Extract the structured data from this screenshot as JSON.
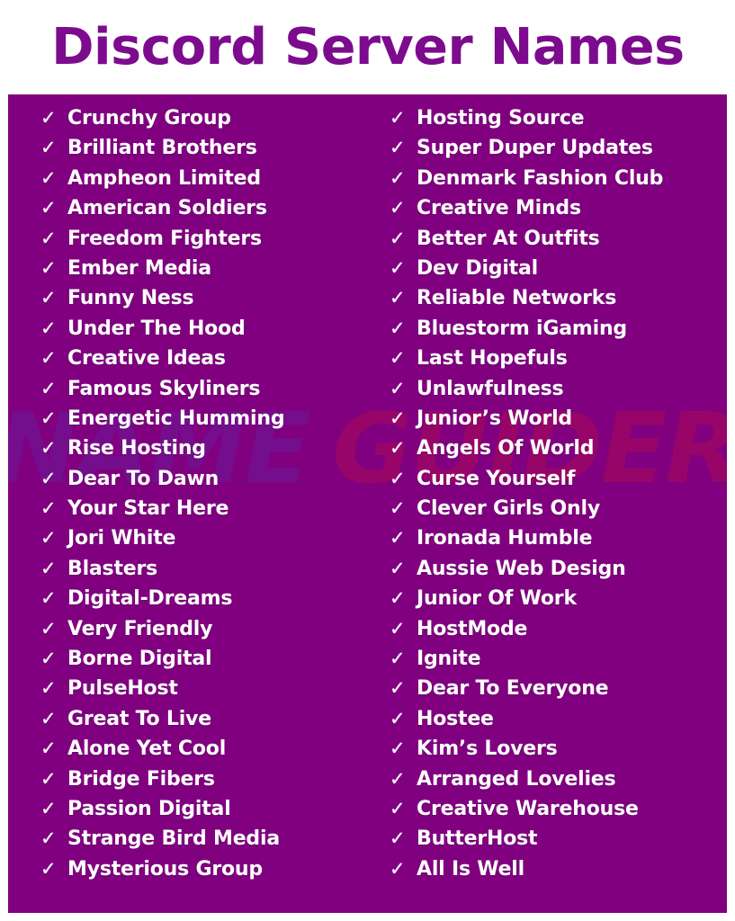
{
  "page": {
    "title": "Discord Server Names",
    "title_color": "#7c0b8e",
    "panel_color": "#800080",
    "text_color": "#ffffff",
    "background_color": "#ffffff"
  },
  "watermark": {
    "word_one": "NAME",
    "word_two": "GUIDER",
    "word_one_color": "#5b2fa8",
    "word_two_color": "#c8103c"
  },
  "bullet": {
    "icon": "check-icon",
    "glyph": "✓"
  },
  "columns": [
    {
      "name": "left-column",
      "items": [
        "Crunchy Group",
        "Brilliant Brothers",
        "Ampheon Limited",
        "American Soldiers",
        "Freedom Fighters",
        "Ember Media",
        "Funny Ness",
        "Under The Hood",
        "Creative Ideas",
        "Famous Skyliners",
        "Energetic Humming",
        "Rise Hosting",
        "Dear To Dawn",
        "Your Star Here",
        "Jori White",
        "Blasters",
        "Digital-Dreams",
        "Very Friendly",
        "Borne Digital",
        "PulseHost",
        "Great To Live",
        "Alone Yet Cool",
        "Bridge Fibers",
        "Passion Digital",
        "Strange Bird Media",
        "Mysterious Group"
      ]
    },
    {
      "name": "right-column",
      "items": [
        "Hosting Source",
        "Super Duper Updates",
        "Denmark Fashion Club",
        "Creative Minds",
        "Better At Outfits",
        "Dev Digital",
        "Reliable Networks",
        "Bluestorm iGaming",
        "Last Hopefuls",
        "Unlawfulness",
        "Junior’s World",
        "Angels Of World",
        "Curse Yourself",
        "Clever Girls Only",
        "Ironada Humble",
        "Aussie Web Design",
        "Junior Of Work",
        "HostMode",
        "Ignite",
        "Dear To Everyone",
        "Hostee",
        "Kim’s Lovers",
        "Arranged Lovelies",
        "Creative Warehouse",
        "ButterHost",
        "All Is Well"
      ]
    }
  ]
}
